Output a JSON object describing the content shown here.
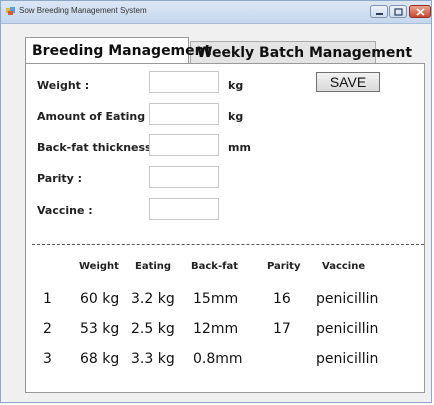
{
  "window": {
    "title": "Sow Breeding Management System"
  },
  "tabs": [
    {
      "label": "Breeding Management",
      "active": true
    },
    {
      "label": "Weekly Batch Management",
      "active": false
    }
  ],
  "form": {
    "weight": {
      "label": "Weight :",
      "value": "",
      "unit": "kg"
    },
    "eating": {
      "label": "Amount of Eating :",
      "value": "",
      "unit": "kg"
    },
    "backfat": {
      "label": "Back-fat thickness :",
      "value": "",
      "unit": "mm"
    },
    "parity": {
      "label": "Parity :",
      "value": ""
    },
    "vaccine": {
      "label": "Vaccine :",
      "value": ""
    },
    "save_label": "SAVE"
  },
  "table": {
    "columns": [
      "Weight",
      "Eating",
      "Back-fat",
      "Parity",
      "Vaccine"
    ],
    "rows": [
      {
        "index": "1",
        "weight": "60 kg",
        "eating": "3.2 kg",
        "backfat": "15mm",
        "parity": "16",
        "vaccine": "penicillin"
      },
      {
        "index": "2",
        "weight": "53 kg",
        "eating": "2.5 kg",
        "backfat": "12mm",
        "parity": "17",
        "vaccine": "penicillin"
      },
      {
        "index": "3",
        "weight": "68 kg",
        "eating": "3.3 kg",
        "backfat": "0.8mm",
        "parity": "",
        "vaccine": "penicillin"
      }
    ]
  },
  "colors": {
    "titlebar": "#c6d7ee",
    "close_button": "#c74a33",
    "panel_background": "#ffffff"
  },
  "icons": [
    "app-icon",
    "minimize-icon",
    "maximize-icon",
    "close-icon"
  ]
}
